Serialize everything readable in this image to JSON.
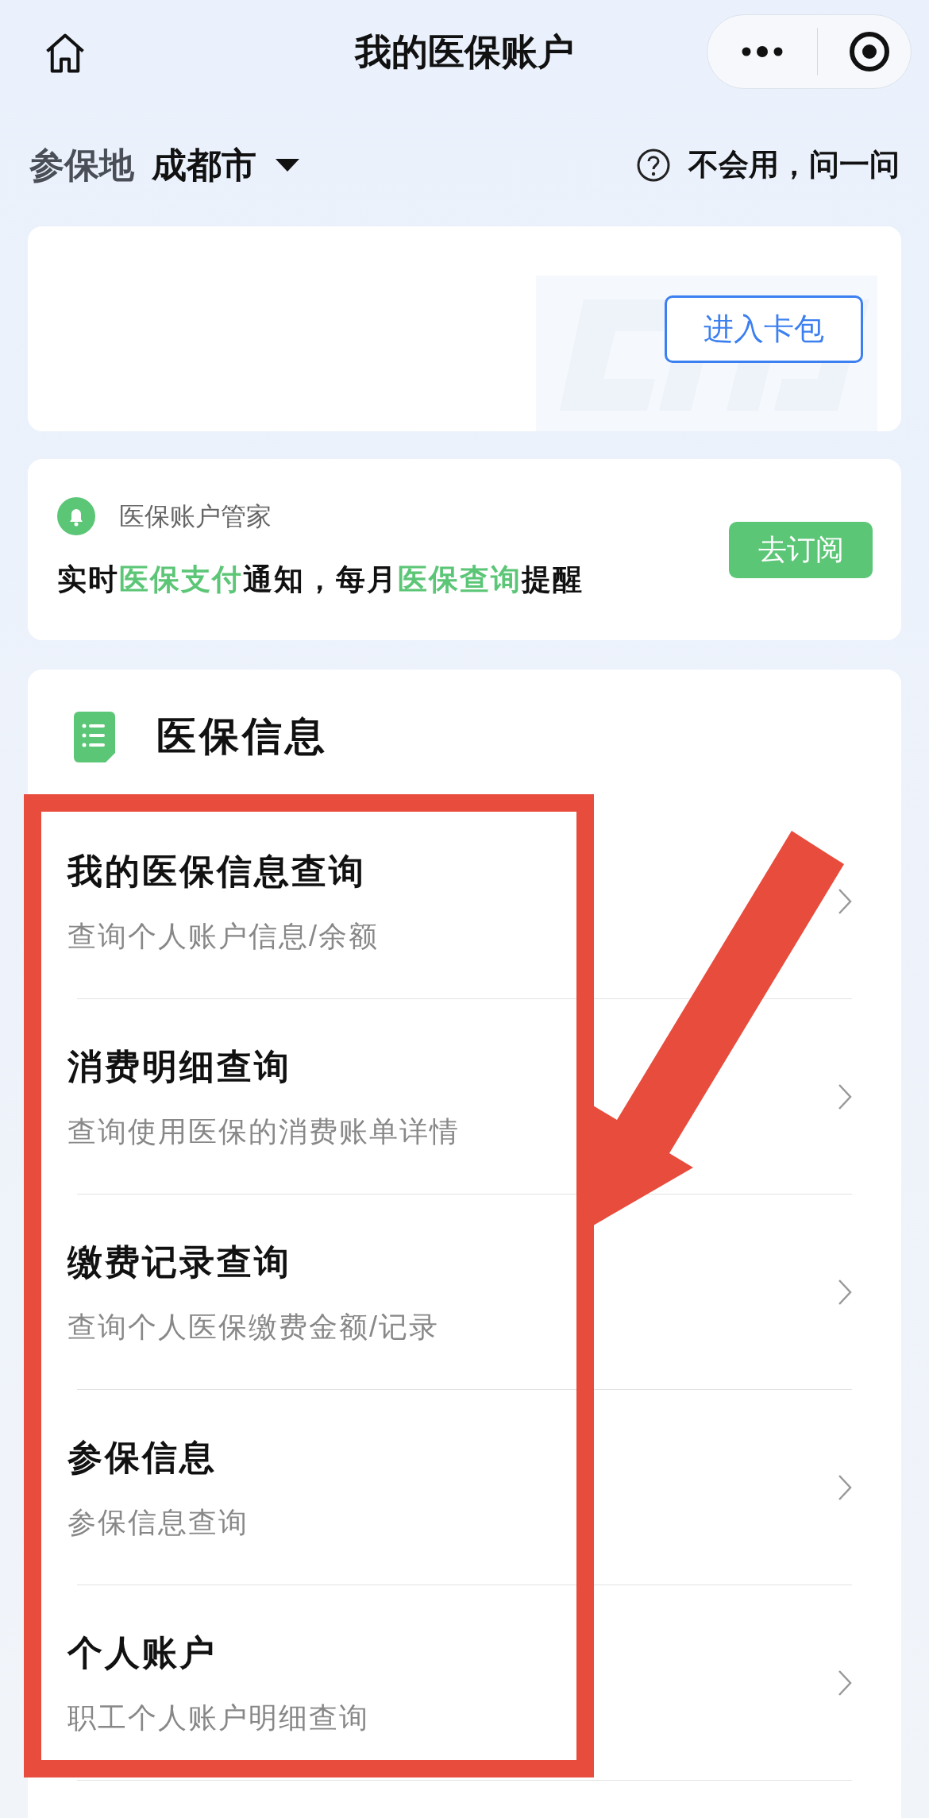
{
  "navbar": {
    "title": "我的医保账户"
  },
  "location": {
    "label": "参保地",
    "city": "成都市"
  },
  "help": {
    "label": "不会用，问一问"
  },
  "card_pack": {
    "button": "进入卡包"
  },
  "subscription": {
    "title": "医保账户管家",
    "message": [
      {
        "text": "实时",
        "highlight": false
      },
      {
        "text": "医保支付",
        "highlight": true
      },
      {
        "text": "通知，每月",
        "highlight": false
      },
      {
        "text": "医保查询",
        "highlight": true
      },
      {
        "text": "提醒",
        "highlight": false
      }
    ],
    "button": "去订阅"
  },
  "info_section": {
    "title": "医保信息",
    "items": [
      {
        "title": "我的医保信息查询",
        "subtitle": "查询个人账户信息/余额"
      },
      {
        "title": "消费明细查询",
        "subtitle": "查询使用医保的消费账单详情"
      },
      {
        "title": "缴费记录查询",
        "subtitle": "查询个人医保缴费金额/记录"
      },
      {
        "title": "参保信息",
        "subtitle": "参保信息查询"
      },
      {
        "title": "个人账户",
        "subtitle": "职工个人账户明细查询"
      }
    ]
  }
}
